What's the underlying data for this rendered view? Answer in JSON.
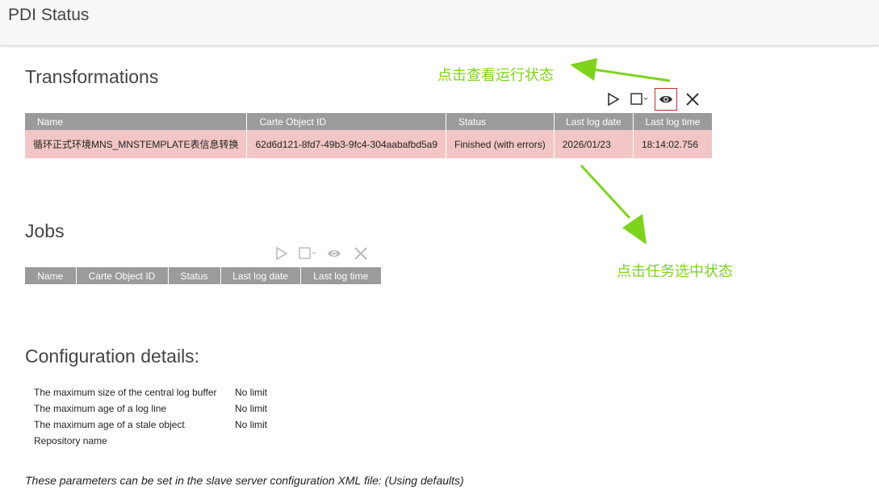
{
  "app": {
    "title": "PDI Status"
  },
  "transformations": {
    "title": "Transformations",
    "toolbar": {
      "icons": [
        "play-icon",
        "stop-icon",
        "chevron-down-icon",
        "eye-icon",
        "close-icon"
      ],
      "selected": "eye-icon"
    },
    "columns": [
      "Name",
      "Carte Object ID",
      "Status",
      "Last log date",
      "Last log time"
    ],
    "rows": [
      {
        "name": "循环正式环境MNS_MNSTEMPLATE表信息转换",
        "id": "62d6d121-8fd7-49b3-9fc4-304aabafbd5a9",
        "status": "Finished (with errors)",
        "date": "2026/01/23",
        "time": "18:14:02.756"
      }
    ]
  },
  "jobs": {
    "title": "Jobs",
    "toolbar": {
      "icons": [
        "play-icon",
        "stop-icon",
        "chevron-down-icon",
        "eye-icon",
        "close-icon"
      ]
    },
    "columns": [
      "Name",
      "Carte Object ID",
      "Status",
      "Last log date",
      "Last log time"
    ]
  },
  "config": {
    "title": "Configuration details:",
    "rows": [
      {
        "key": "The maximum size of the central log buffer",
        "value": "No limit"
      },
      {
        "key": "The maximum age of a log line",
        "value": "No limit"
      },
      {
        "key": "The maximum age of a stale object",
        "value": "No limit"
      },
      {
        "key": "Repository name",
        "value": ""
      }
    ],
    "footnote": "These parameters can be set in the slave server configuration XML file: (Using defaults)"
  },
  "annotations": {
    "view_status": "点击查看运行状态",
    "select_state": "点击任务选中状态"
  },
  "colors": {
    "header_bg": "#9b9b9b",
    "error_row_bg": "#f2c6c6",
    "annotation": "#7ed31b",
    "selected_border": "#c0302a"
  }
}
